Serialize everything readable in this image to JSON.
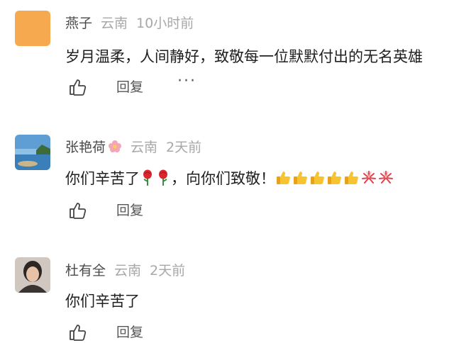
{
  "comments": [
    {
      "name": "燕子",
      "location": "云南",
      "time": "10小时前",
      "text": "岁月温柔，人间静好，致敬每一位默默付出的无名英雄",
      "avatar": "orange-square-avatar",
      "reply_label": "回复",
      "more_label": "···"
    },
    {
      "name": "张艳荷",
      "name_icon": "flower-icon",
      "location": "云南",
      "time": "2天前",
      "text_parts": [
        "你们辛苦了",
        "，向你们致敬！"
      ],
      "emojis_after_part1": [
        "rose-icon",
        "rose-icon"
      ],
      "emojis_after_part2": [
        "thumbs-up-icon",
        "thumbs-up-icon",
        "thumbs-up-icon",
        "thumbs-up-icon",
        "thumbs-up-icon",
        "firework-icon",
        "firework-icon"
      ],
      "avatar": "lake-landscape-avatar",
      "reply_label": "回复"
    },
    {
      "name": "杜有全",
      "location": "云南",
      "time": "2天前",
      "text": "你们辛苦了",
      "avatar": "person-photo-avatar",
      "reply_label": "回复"
    }
  ],
  "colors": {
    "name": "#4a4a4a",
    "meta": "#a8a8a8",
    "text": "#1f1f1f",
    "avatar_orange": "#f6a94f"
  }
}
